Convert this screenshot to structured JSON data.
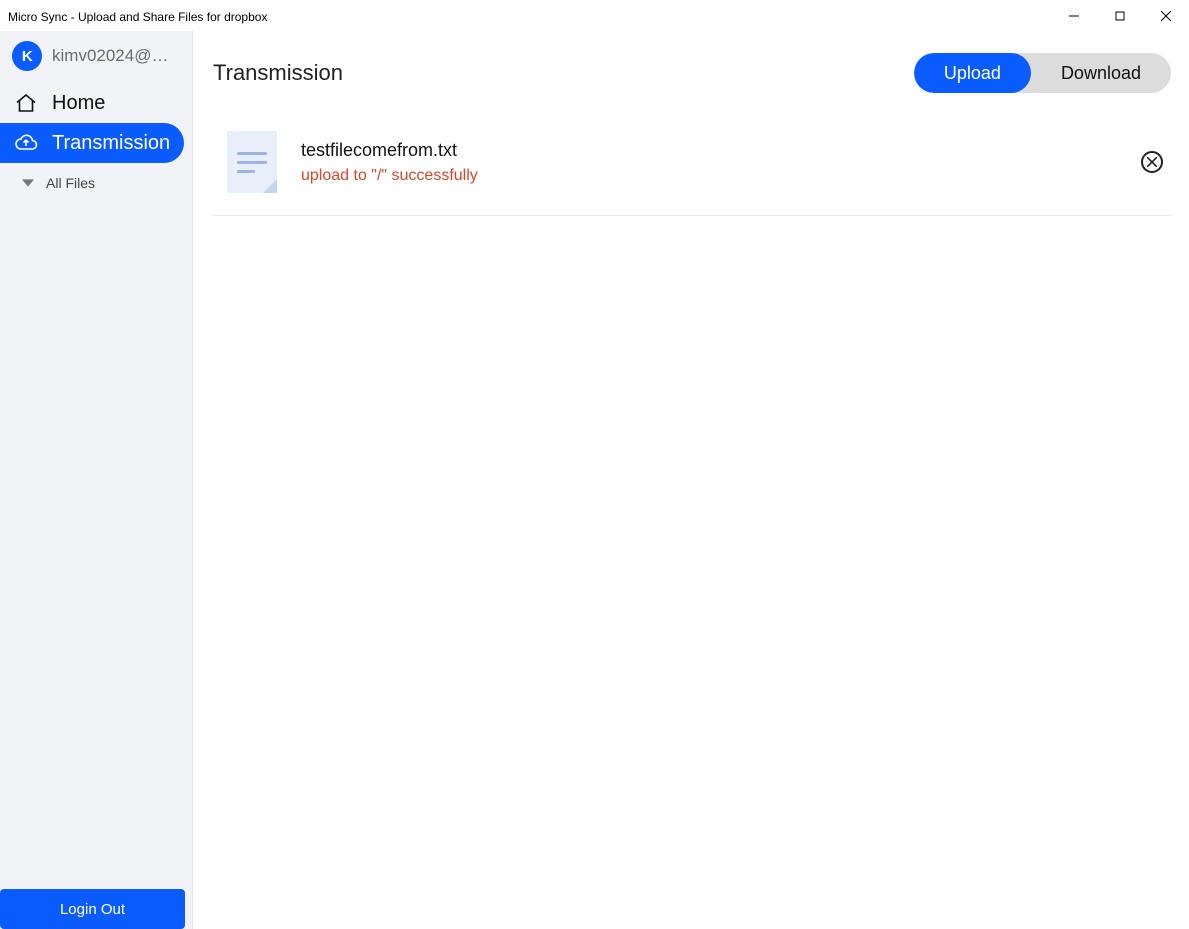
{
  "window": {
    "title": "Micro Sync - Upload and Share Files for dropbox"
  },
  "sidebar": {
    "avatar_letter": "K",
    "user_email": "kimv02024@…",
    "items": [
      {
        "label": "Home"
      },
      {
        "label": "Transmission"
      },
      {
        "label": "All Files"
      }
    ],
    "logout_label": "Login Out"
  },
  "main": {
    "title": "Transmission",
    "toggle": {
      "upload_label": "Upload",
      "download_label": "Download",
      "active": "upload"
    },
    "files": [
      {
        "name": "testfilecomefrom.txt",
        "status": "upload to \"/\" successfully"
      }
    ]
  }
}
